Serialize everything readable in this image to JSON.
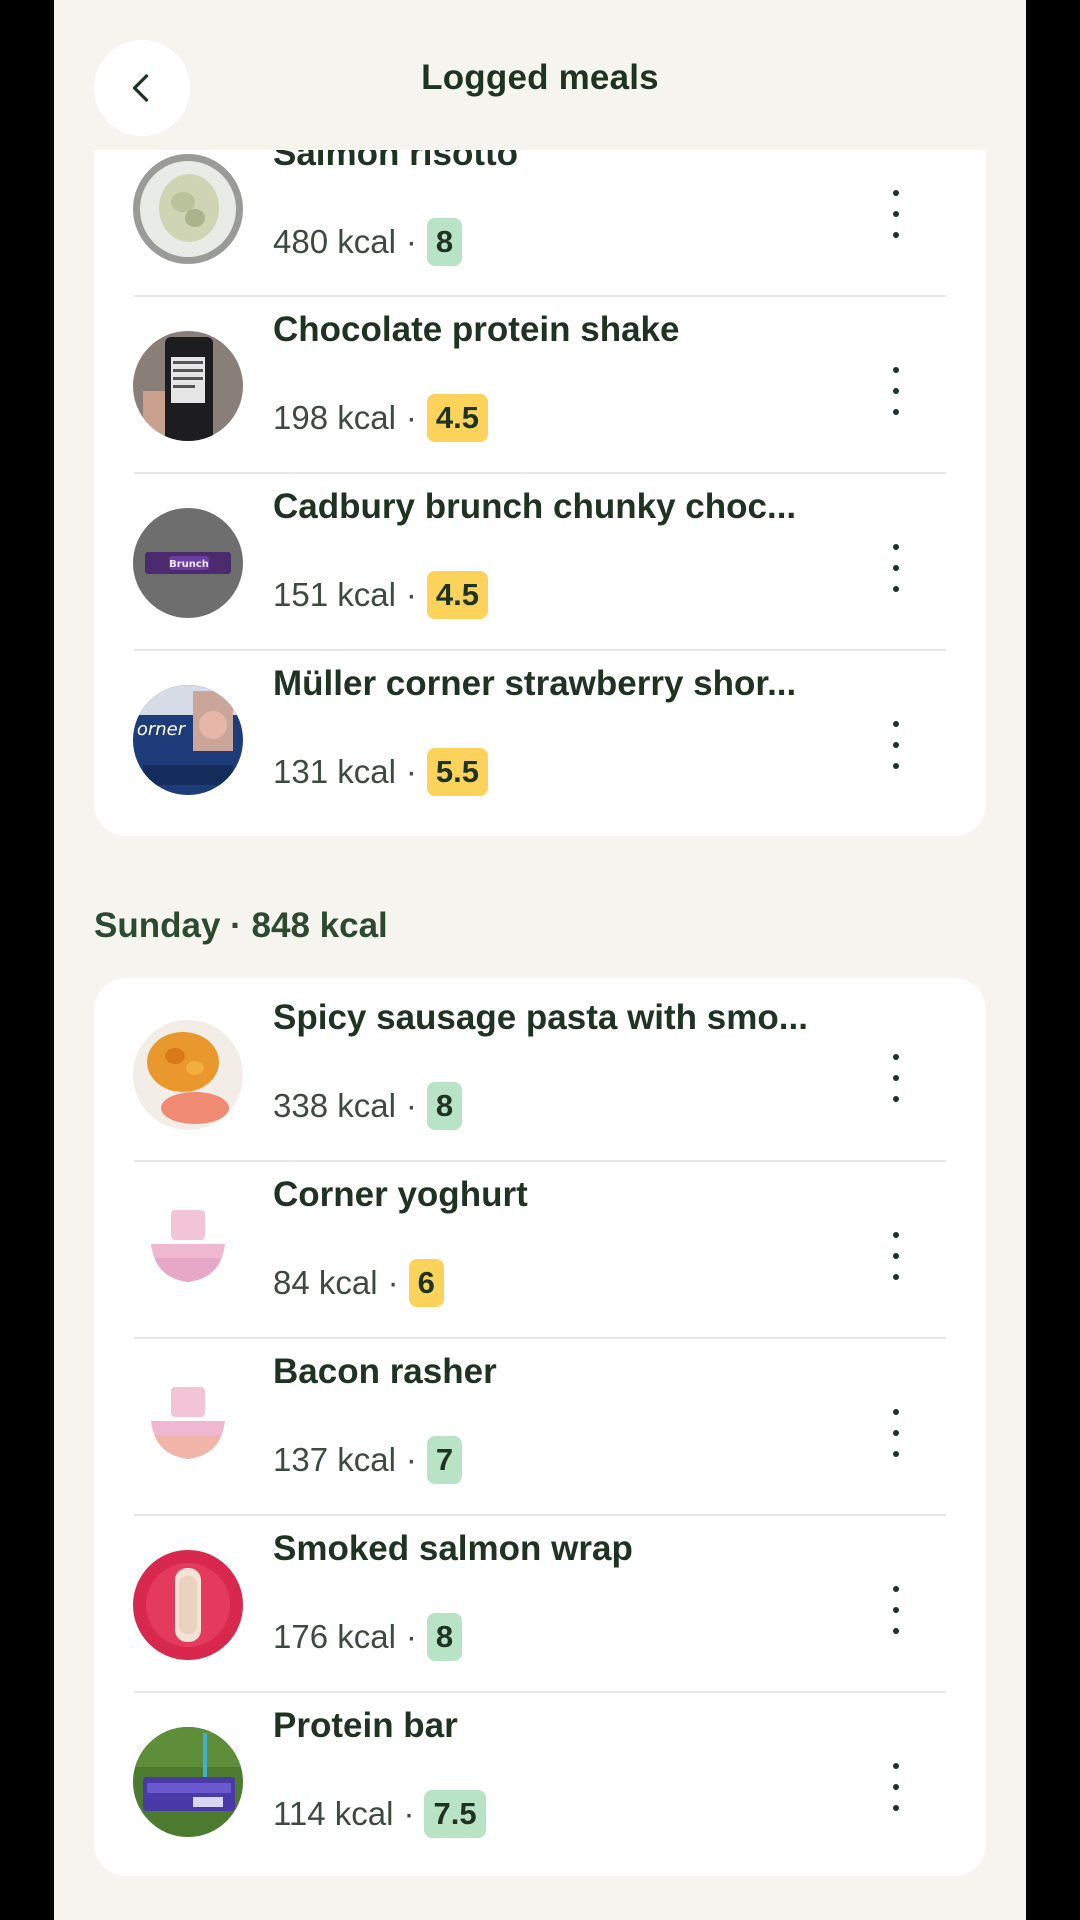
{
  "header": {
    "title": "Logged meals",
    "back_icon": "chevron-left-icon"
  },
  "groups": [
    {
      "title": "",
      "meals": [
        {
          "name": "Salmon risotto",
          "kcal": "480 kcal",
          "score": "8",
          "score_color": "green",
          "thumb": "risotto-photo"
        },
        {
          "name": "Chocolate protein shake",
          "kcal": "198 kcal",
          "score": "4.5",
          "score_color": "yellow",
          "thumb": "shake-bottle-photo"
        },
        {
          "name": "Cadbury brunch chunky choc...",
          "kcal": "151 kcal",
          "score": "4.5",
          "score_color": "yellow",
          "thumb": "brunch-bar-photo"
        },
        {
          "name": "Müller corner strawberry shor...",
          "kcal": "131 kcal",
          "score": "5.5",
          "score_color": "yellow",
          "thumb": "muller-corner-photo"
        }
      ]
    },
    {
      "title": "Sunday · 848 kcal",
      "meals": [
        {
          "name": "Spicy sausage pasta with smo...",
          "kcal": "338 kcal",
          "score": "8",
          "score_color": "green",
          "thumb": "pasta-photo"
        },
        {
          "name": "Corner yoghurt",
          "kcal": "84 kcal",
          "score": "6",
          "score_color": "yellow",
          "thumb": "bowl-placeholder-icon"
        },
        {
          "name": "Bacon rasher",
          "kcal": "137 kcal",
          "score": "7",
          "score_color": "green",
          "thumb": "bowl-placeholder-icon"
        },
        {
          "name": "Smoked salmon wrap",
          "kcal": "176 kcal",
          "score": "8",
          "score_color": "green",
          "thumb": "wrap-photo"
        },
        {
          "name": "Protein bar",
          "kcal": "114 kcal",
          "score": "7.5",
          "score_color": "green",
          "thumb": "protein-bar-photo"
        }
      ]
    }
  ],
  "colors": {
    "background": "#f6f4ef",
    "card": "#ffffff",
    "text": "#1f3322",
    "badge_green": "#b8e3c5",
    "badge_yellow": "#fbd35a"
  }
}
